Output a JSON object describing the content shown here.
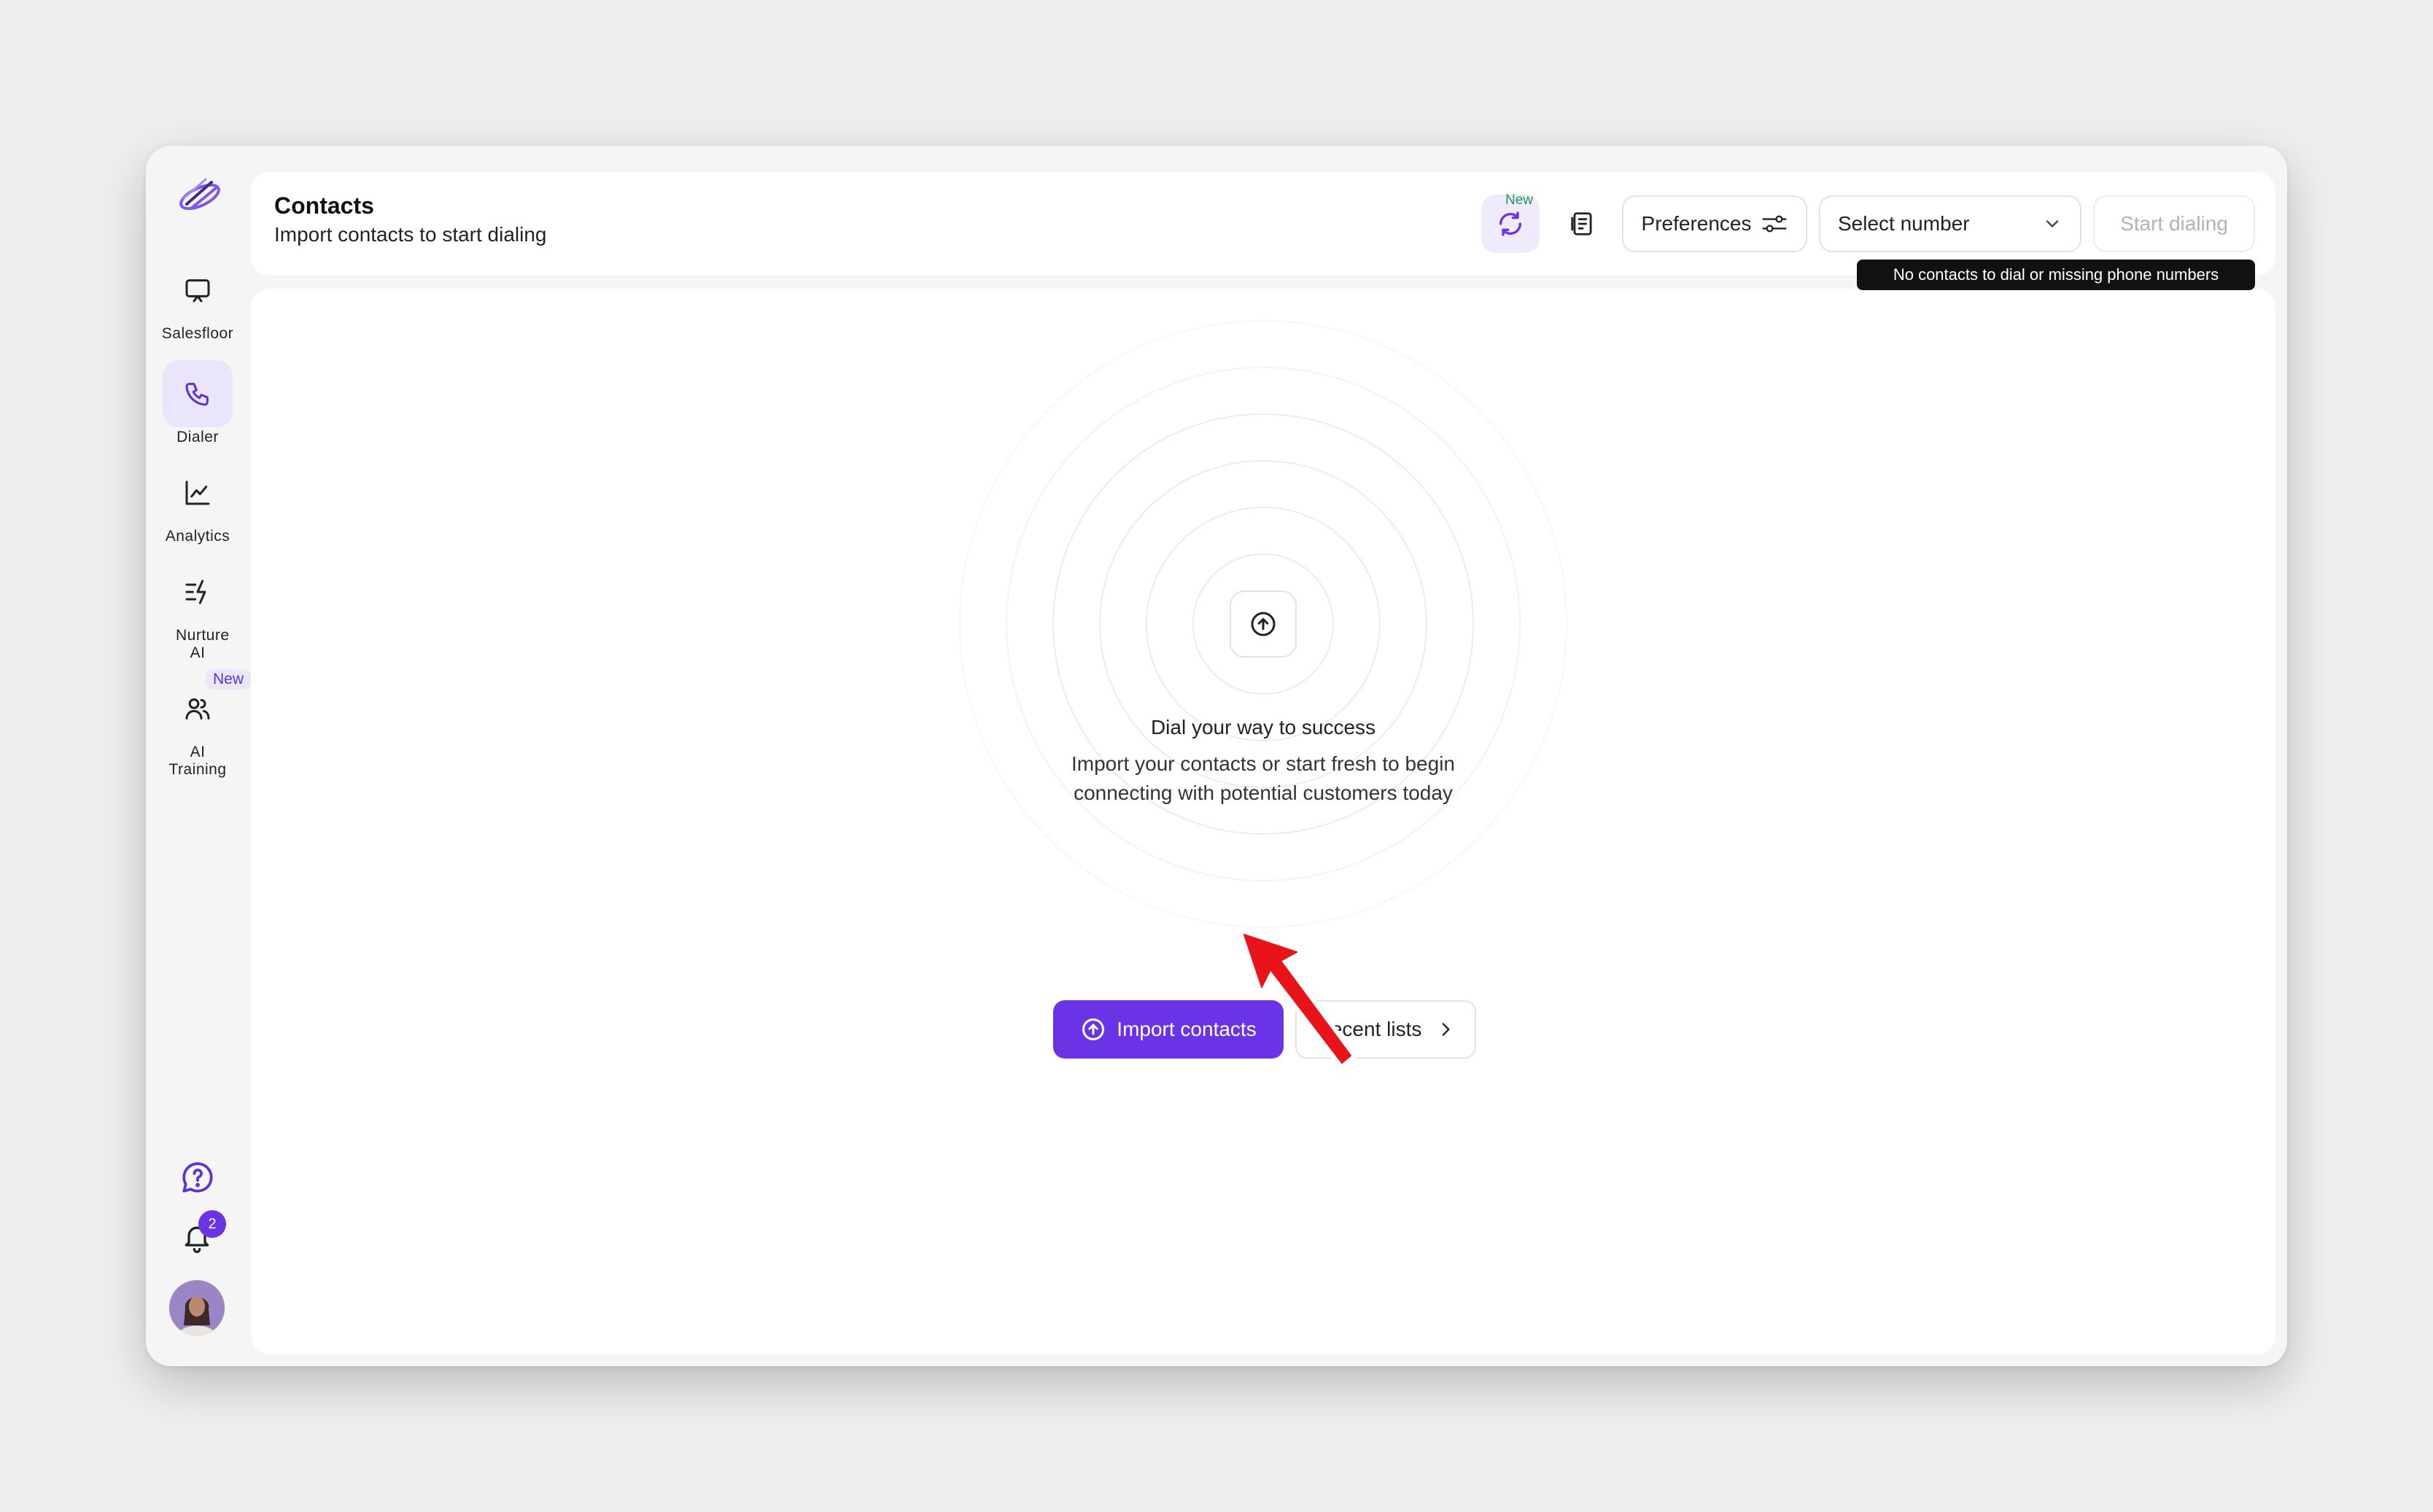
{
  "sidebar": {
    "items": [
      {
        "label": "Salesfloor",
        "icon": "monitor-icon"
      },
      {
        "label": "Dialer",
        "icon": "phone-icon",
        "active": true
      },
      {
        "label": "Analytics",
        "icon": "line-chart-icon"
      },
      {
        "label": "Nurture AI",
        "icon": "lightning-list-icon"
      },
      {
        "label": "AI Training",
        "icon": "users-icon",
        "badge": "New"
      }
    ],
    "notification_count": "2"
  },
  "header": {
    "title": "Contacts",
    "subtitle": "Import contacts to start dialing",
    "sync_badge": "New",
    "preferences_label": "Preferences",
    "select_number_label": "Select number",
    "start_dialing_label": "Start dialing",
    "tooltip": "No contacts to dial or missing phone numbers"
  },
  "empty_state": {
    "title": "Dial your way to success",
    "description_line1": "Import your contacts or start fresh to begin",
    "description_line2": "connecting with potential customers today",
    "import_label": "Import contacts",
    "recent_label": "Recent lists"
  },
  "colors": {
    "accent": "#6a33e6",
    "accent_soft": "#ebe5fb",
    "annotation_arrow": "#e8141a"
  }
}
